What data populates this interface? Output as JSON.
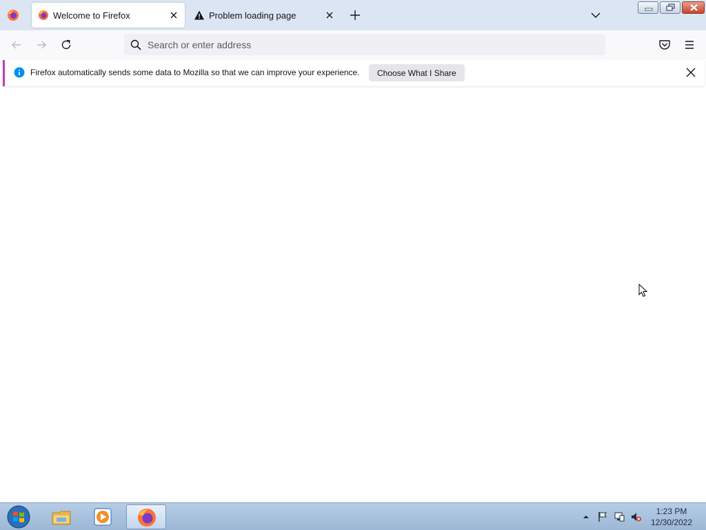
{
  "tabs": [
    {
      "title": "Welcome to Firefox",
      "icon": "firefox-icon",
      "active": true
    },
    {
      "title": "Problem loading page",
      "icon": "warning-icon",
      "active": false
    }
  ],
  "toolbar": {
    "url_placeholder": "Search or enter address"
  },
  "notification": {
    "message": "Firefox automatically sends some data to Mozilla so that we can improve your experience.",
    "button_label": "Choose What I Share",
    "accent_color": "#c13bb4"
  },
  "taskbar": {
    "apps": [
      "windows-explorer-icon",
      "media-player-icon",
      "firefox-icon"
    ],
    "active_app": "firefox-icon",
    "clock": {
      "time": "1:23 PM",
      "date": "12/30/2022"
    }
  },
  "colors": {
    "titlebar_bg": "#dbe5f3",
    "toolbar_bg": "#f9f9fb",
    "urlbar_bg": "#f0f0f4"
  }
}
